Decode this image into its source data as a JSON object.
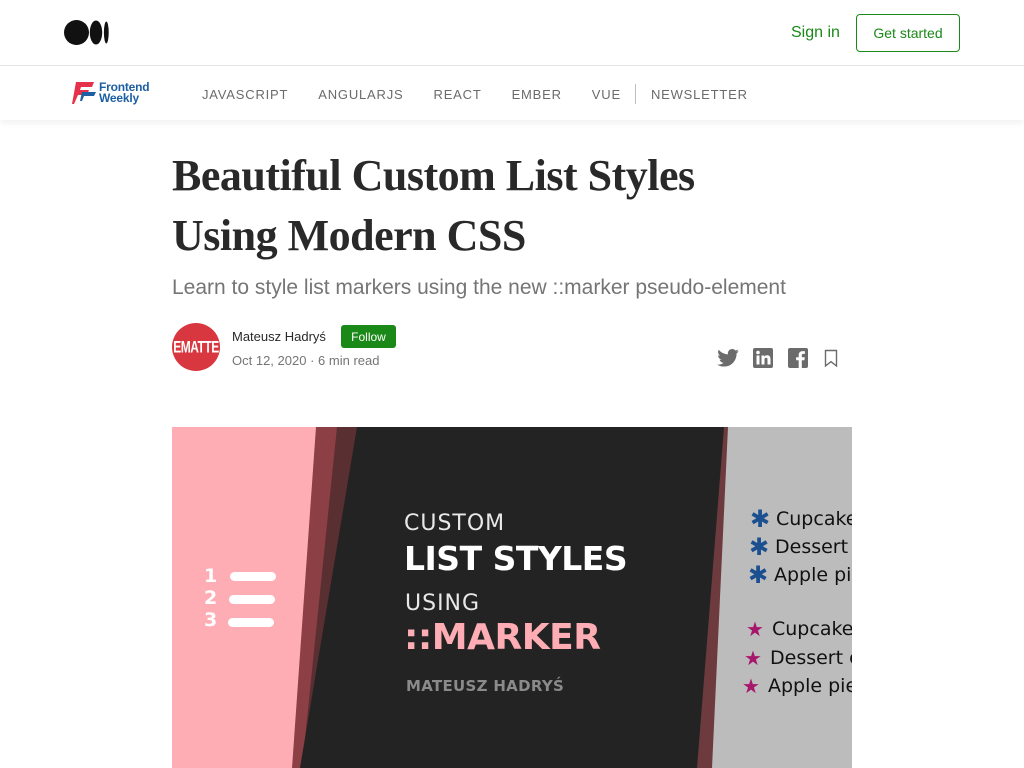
{
  "header": {
    "sign_in": "Sign in",
    "get_started": "Get started"
  },
  "publication": {
    "name_line1": "Frontend",
    "name_line2": "Weekly",
    "nav": [
      "JAVASCRIPT",
      "ANGULARJS",
      "REACT",
      "EMBER",
      "VUE"
    ],
    "newsletter": "NEWSLETTER"
  },
  "article": {
    "title_line1": "Beautiful Custom List Styles",
    "title_line2": "Using Modern CSS",
    "subtitle": "Learn to style list markers using the new ::marker pseudo-element",
    "author": "Mateusz Hadryś",
    "avatar_text": "EMATTE",
    "follow": "Follow",
    "date": "Oct 12, 2020",
    "read_time": "6 min read",
    "meta_sep": "·"
  },
  "share_icons": [
    "twitter-icon",
    "linkedin-icon",
    "facebook-icon",
    "bookmark-icon"
  ],
  "hero": {
    "line1": "CUSTOM",
    "line2": "LIST STYLES",
    "line3": "USING",
    "line4": "::MARKER",
    "author": "MATEUSZ HADRYŚ",
    "numbers": [
      "1",
      "2",
      "3"
    ],
    "list_blue": [
      "Cupcake",
      "Dessert",
      "Apple pie"
    ],
    "list_pink": [
      "Cupcake",
      "Dessert c",
      "Apple pie"
    ],
    "marker_blue": "✱",
    "marker_pink": "★",
    "colors": {
      "pink": "#ffadb5",
      "dark": "#232323",
      "gray": "#bcbcbc",
      "blue_marker": "#1b4f8f",
      "pink_marker": "#a6166b"
    }
  },
  "colors": {
    "accent_green": "#1a8917",
    "text": "#292929",
    "muted": "#757575"
  }
}
